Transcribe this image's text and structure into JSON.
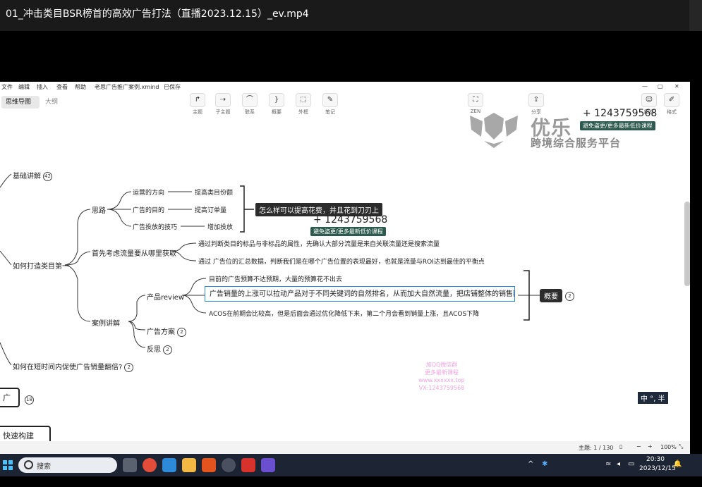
{
  "player": {
    "title": "01_冲击类目BSR榜首的高效广告打法（直播2023.12.15）_ev.mp4"
  },
  "menubar": {
    "items": [
      "文件",
      "编辑",
      "插入",
      "查看",
      "帮助",
      "老思广告推广案例.xmind",
      "已保存"
    ]
  },
  "tabs": {
    "mindmap": "思维导图",
    "outline": "大纲"
  },
  "toolbar": {
    "tools": [
      {
        "icon": "subtopic-icon",
        "glyph": "↱",
        "label": "主题"
      },
      {
        "icon": "child-topic-icon",
        "glyph": "⇢",
        "label": "子主题"
      },
      {
        "icon": "relationship-icon",
        "glyph": "⌒",
        "label": "联系"
      },
      {
        "icon": "summary-icon",
        "glyph": "}",
        "label": "概要"
      },
      {
        "icon": "boundary-icon",
        "glyph": "⬚",
        "label": "外框"
      },
      {
        "icon": "note-icon",
        "glyph": "✎",
        "label": "笔记"
      }
    ],
    "right_tools": [
      {
        "icon": "zen-icon",
        "glyph": "⛶",
        "label": "ZEN"
      },
      {
        "icon": "share-icon",
        "glyph": "⇪",
        "label": "分享"
      },
      {
        "icon": "sticker-icon",
        "glyph": "☺",
        "label": "图标"
      },
      {
        "icon": "format-icon",
        "glyph": "✐",
        "label": "格式"
      }
    ]
  },
  "mindmap": {
    "basic": "基础讲解",
    "basic_count": "42",
    "how_first": "如何打造类目第一",
    "thinking": "思路",
    "t1": "运营的方向",
    "t1r": "提高类目份额",
    "t2": "广告的目的",
    "t2r": "提高订单量",
    "t3": "广告投放的技巧",
    "t3r": "增加投放",
    "dark_label": "怎么样可以提高花费，并且花到刀刃上",
    "first_consider": "首先考虑流量要从哪里获取",
    "fc1": "通过判断类目的标品与非标品的属性，先确认大部分流量是来自关联流量还是搜索流量",
    "fc2": "通过 广告位的汇总数据，判断我们是在哪个广告位置的表现最好，也就是流量与ROI达到最佳的平衡点",
    "case": "案例讲解",
    "review": "产品review",
    "r1": "目前的广告预算不达预期，大量的预算花不出去",
    "r2": "广告销量的上涨可以拉动产品对于不同关键词的自然排名，从而加大自然流量，把店铺整体的销售额做大",
    "r3": "ACOS在前期会比较高，但是后面会通过优化降低下来，第二个月会看到销量上涨，且ACOS下降",
    "summary": "概要",
    "summary_count": "2",
    "plan": "广告方案",
    "plan_count": "2",
    "reflect": "反思",
    "reflect_count": "2",
    "double": "如何在短时间内促使广告销量翻倍?",
    "double_count": "2",
    "box1": "广",
    "box1_count": "18",
    "box2": "快速构建"
  },
  "watermark": {
    "brand": "优乐",
    "subtitle": "跨境综合服务平台",
    "qq": "+ 1243759568",
    "badge": "避免盗更/更多最新低价课程",
    "pink_lines": [
      "加QQ微信群",
      "更多最新课程",
      "www.xxxxxx.top",
      "VX:1243759568"
    ]
  },
  "app_status": {
    "topics": "主题: 1 / 130",
    "zoom": "100%"
  },
  "ime": "中 °, 半",
  "taskbar": {
    "search": "搜索",
    "time": "20:30",
    "date": "2023/12/15"
  }
}
